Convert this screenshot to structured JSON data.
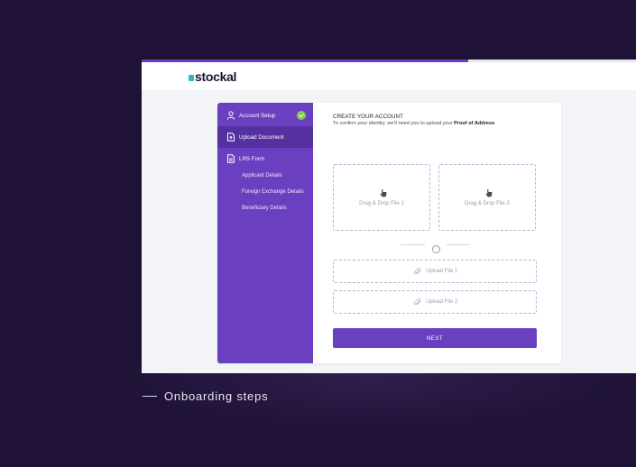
{
  "app": {
    "logo_text": "stockal",
    "progress": 0.66
  },
  "sidebar": {
    "account_setup": "Account Setup",
    "upload_document": "Upload Document",
    "lrs_form": "LRS Form",
    "sub_items": [
      "Applicant Details",
      "Foreign Exchange Details",
      "Beneficiary Details"
    ]
  },
  "main": {
    "title": "CREATE YOUR ACCOUNT",
    "subtitle": "To confirm your identity, we'll need you to upload your",
    "subtitle_bold": "Proof of Address",
    "drop1": "Drag & Drop File 1",
    "drop2": "Drag & Drop File 2",
    "upload1": "Upload File 1",
    "upload2": "Upload File 2",
    "next": "NEXT"
  },
  "caption": "Onboarding steps",
  "colors": {
    "background": "#1f1236",
    "accent": "#6a3fc0",
    "active_nav": "#55309f",
    "success": "#7fcf4a",
    "logo_mark": "#2bb8c9"
  }
}
